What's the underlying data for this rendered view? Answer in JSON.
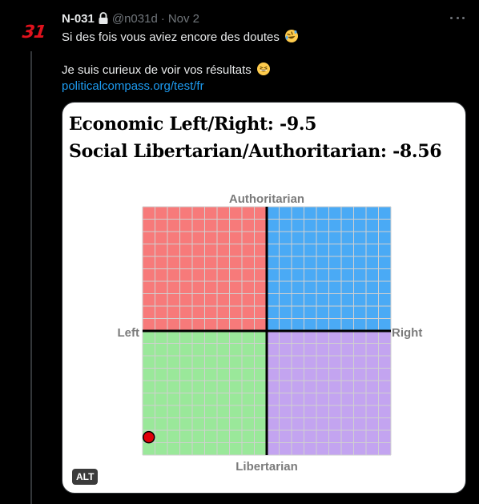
{
  "author": {
    "avatar_text": "31",
    "name": "N-031",
    "handle": "@n031d",
    "separator": "·",
    "date": "Nov 2"
  },
  "tweet": {
    "line1": "Si des fois vous aviez encore des doutes",
    "line2": "Je suis curieux de voir vos résultats",
    "link": "politicalcompass.org/test/fr"
  },
  "emojis": [
    "rolling-on-floor-laughing-emoji",
    "grinning-squinting-emoji"
  ],
  "image": {
    "economic_line": "Economic Left/Right: -9.5",
    "social_line": "Social Libertarian/Authoritarian: -8.56",
    "economic_value": -9.5,
    "social_value": -8.56,
    "axis_labels": {
      "top": "Authoritarian",
      "bottom": "Libertarian",
      "left": "Left",
      "right": "Right"
    },
    "quadrant_colors": {
      "top_left": "#f77a7a",
      "top_right": "#4aaaf5",
      "bottom_left": "#9ae89a",
      "bottom_right": "#c3a4f0"
    },
    "grid_lines": 20,
    "alt_badge": "ALT"
  }
}
